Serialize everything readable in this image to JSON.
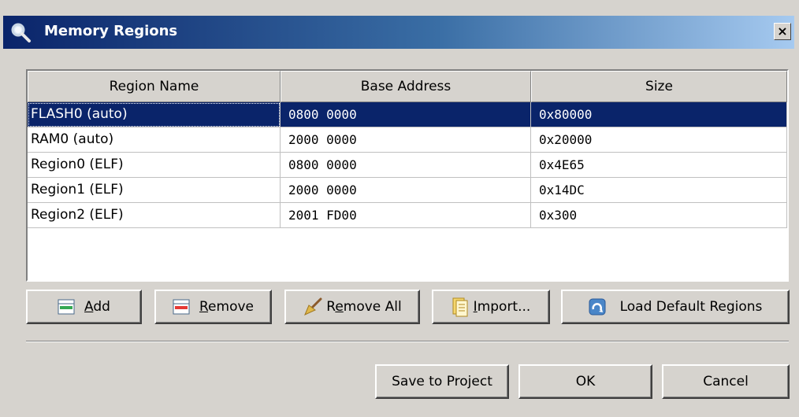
{
  "window": {
    "title": "Memory Regions",
    "close_glyph": "×",
    "title_icon": "magnifier-icon"
  },
  "table": {
    "columns": [
      "Region Name",
      "Base Address",
      "Size"
    ],
    "rows": [
      {
        "name": "FLASH0 (auto)",
        "base": "0800 0000",
        "size": "0x80000",
        "selected": true
      },
      {
        "name": "RAM0 (auto)",
        "base": "2000 0000",
        "size": "0x20000",
        "selected": false
      },
      {
        "name": "Region0 (ELF)",
        "base": "0800 0000",
        "size": "0x4E65",
        "selected": false
      },
      {
        "name": "Region1 (ELF)",
        "base": "2000 0000",
        "size": "0x14DC",
        "selected": false
      },
      {
        "name": "Region2 (ELF)",
        "base": "2001 FD00",
        "size": "0x300",
        "selected": false
      }
    ]
  },
  "actions": {
    "add": {
      "mnemonic": "A",
      "rest": "dd",
      "icon": "add-row-icon"
    },
    "remove": {
      "mnemonic": "R",
      "rest": "emove",
      "icon": "remove-row-icon"
    },
    "remove_all": {
      "pre": "R",
      "mnemonic": "e",
      "rest": "move All",
      "icon": "broom-icon"
    },
    "import": {
      "mnemonic": "I",
      "rest": "mport...",
      "icon": "document-icon"
    },
    "load_default": {
      "label": "Load Default Regions",
      "icon": "refresh-icon"
    }
  },
  "footer": {
    "save_label": "Save to Project",
    "ok_label": "OK",
    "cancel_label": "Cancel"
  },
  "colors": {
    "selection": "#0a246a",
    "title_gradient_start": "#0a246a",
    "title_gradient_end": "#a6caf0",
    "face": "#d6d3ce"
  }
}
